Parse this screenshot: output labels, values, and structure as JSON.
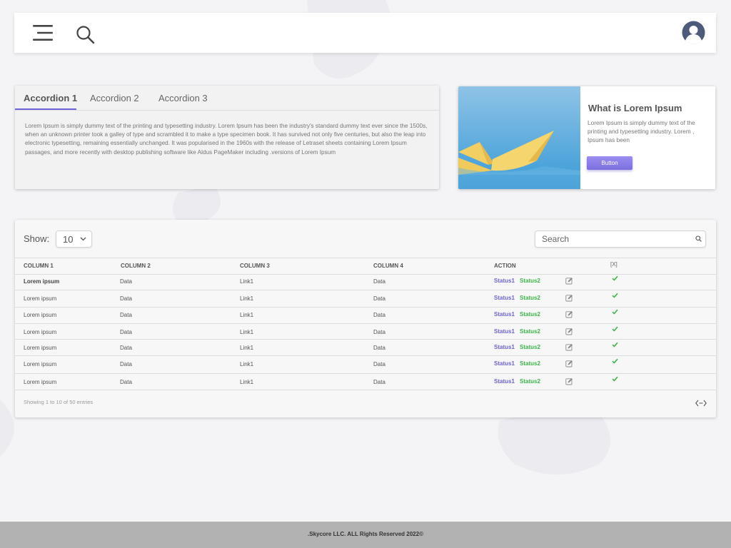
{
  "accordion": {
    "tabs": [
      "Accordion 1",
      "Accordion 2",
      "Accordion 3"
    ],
    "active_tab": 0,
    "text": "Lorem Ipsum is simply dummy text of the printing and typesetting industry. Lorem Ipsum has been the industry's standard dummy text ever since the 1500s, when an unknown printer took a galley of type and scrambled it to make a type specimen book. It has survived not only five centuries, but also the leap into electronic typesetting, remaining essentially unchanged. It was popularised in the 1960s with the release of Letraset sheets containing Lorem Ipsum passages, and more recently with desktop publishing software like Aldus PageMaker including .versions of Lorem Ipsum"
  },
  "card": {
    "title": "What is Lorem Ipsum",
    "text": "Lorem Ipsum is simply dummy text of the printing and typesetting industry. Lorem , Ipsum has been",
    "button_label": "Button"
  },
  "table": {
    "show_label": "Show:",
    "show_value": "10",
    "search_placeholder": "Search",
    "columns": [
      "COLUMN 1",
      "COLUMN 2",
      "COLUMN 3",
      "COLUMN 4",
      "ACTION",
      "[X]"
    ],
    "rows": [
      {
        "c1": "Lorem ipsum",
        "c2": "Data",
        "c3": "Link1",
        "c4": "Data",
        "s1": "Status1",
        "s2": "Status2",
        "checked": true
      },
      {
        "c1": "Lorem ipsum",
        "c2": "Data",
        "c3": "Link1",
        "c4": "Data",
        "s1": "Status1",
        "s2": "Status2",
        "checked": true
      },
      {
        "c1": "Lorem ipsum",
        "c2": "Data",
        "c3": "Link1",
        "c4": "Data",
        "s1": "Status1",
        "s2": "Status2",
        "checked": true
      },
      {
        "c1": "Lorem ipsum",
        "c2": "Data",
        "c3": "Link1",
        "c4": "Data",
        "s1": "Status1",
        "s2": "Status2",
        "checked": true
      },
      {
        "c1": "Lorem ipsum",
        "c2": "Data",
        "c3": "Link1",
        "c4": "Data",
        "s1": "Status1",
        "s2": "Status2",
        "checked": true
      },
      {
        "c1": "Lorem ipsum",
        "c2": "Data",
        "c3": "Link1",
        "c4": "Data",
        "s1": "Status1",
        "s2": "Status2",
        "checked": true
      },
      {
        "c1": "Lorem ipsum",
        "c2": "Data",
        "c3": "Link1",
        "c4": "Data",
        "s1": "Status1",
        "s2": "Status2",
        "checked": true
      }
    ],
    "info": "Showing 1 to 10 of 50 entries"
  },
  "footer": {
    "text": ".Skycore LLC. ALL Rights Reserved 2022©"
  },
  "colors": {
    "accent": "#6b63d6",
    "status1": "#6e63cf",
    "status2": "#3fb44b",
    "footer_bg": "#b2b2b2",
    "button": "#8a7ee8"
  },
  "icons": {
    "menu": "menu-icon",
    "search": "search-icon",
    "user": "user-avatar-icon",
    "edit": "edit-icon",
    "check": "check-icon",
    "code": "code-icon",
    "dropdown": "chevron-down-icon"
  }
}
